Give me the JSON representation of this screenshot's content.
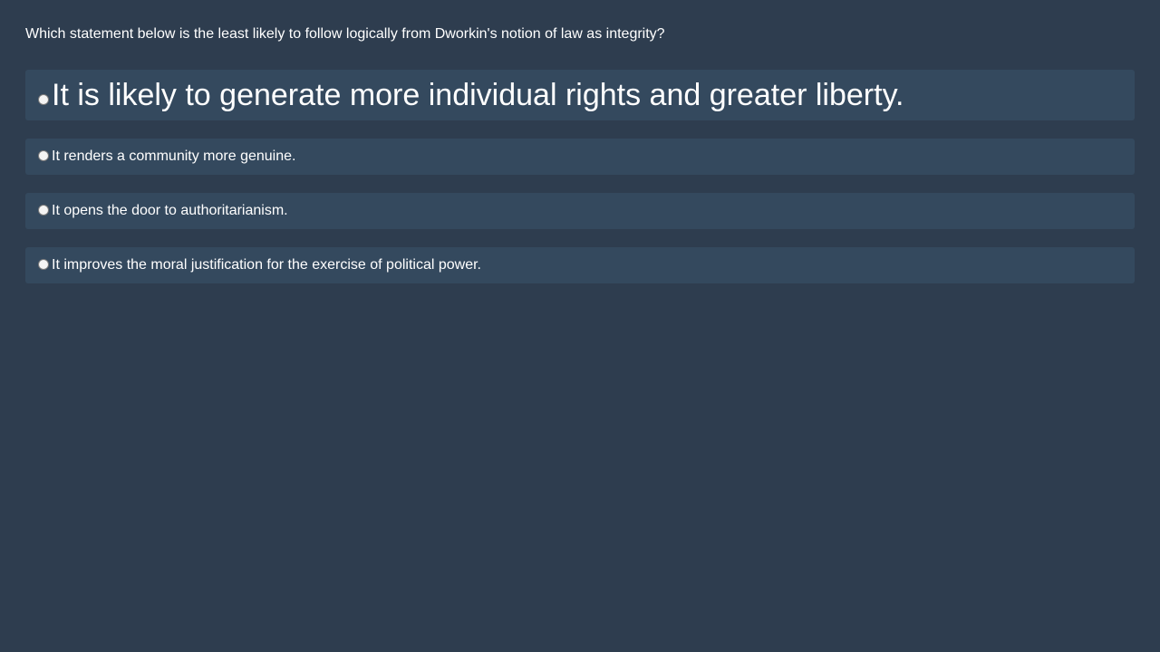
{
  "question": {
    "text": "Which statement below is the least likely to follow logically from Dworkin's notion of law as integrity?"
  },
  "options": [
    {
      "label": "It is likely to generate more individual rights and greater liberty.",
      "selected": false
    },
    {
      "label": "It renders a community more genuine.",
      "selected": false
    },
    {
      "label": "It opens the door to authoritarianism.",
      "selected": false
    },
    {
      "label": "It improves the moral justification for the exercise of political power.",
      "selected": false
    }
  ],
  "colors": {
    "background": "#2e3d4f",
    "option_background": "#34495e",
    "text": "#ffffff"
  }
}
